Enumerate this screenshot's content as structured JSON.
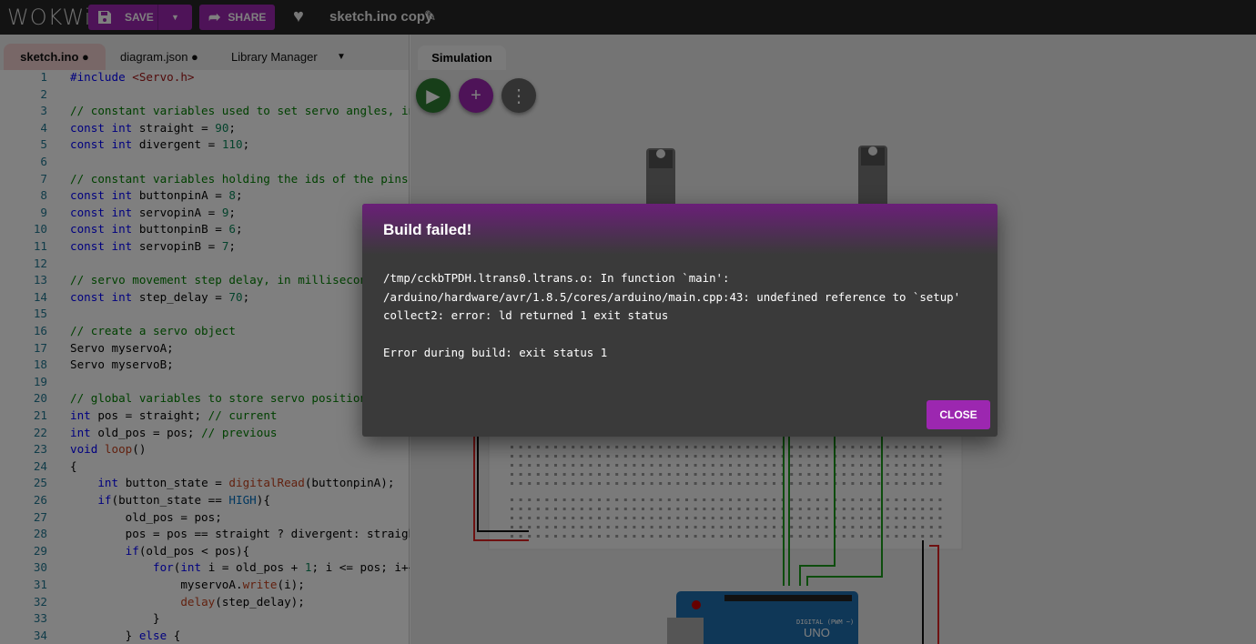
{
  "topbar": {
    "logo": "WOKWi",
    "save_label": "SAVE",
    "share_label": "SHARE",
    "project_title": "sketch.ino copy"
  },
  "editor": {
    "tabs": [
      {
        "label": "sketch.ino ●"
      },
      {
        "label": "diagram.json ●"
      },
      {
        "label": "Library Manager"
      }
    ],
    "lines": [
      [
        [
          "pp",
          "#include "
        ],
        [
          "str",
          "<Servo.h>"
        ]
      ],
      [],
      [
        [
          "cm",
          "// constant variables used to set servo angles, in degrees"
        ]
      ],
      [
        [
          "kw",
          "const int "
        ],
        [
          "",
          "straight = "
        ],
        [
          "num",
          "90"
        ],
        [
          "",
          ";"
        ]
      ],
      [
        [
          "kw",
          "const int "
        ],
        [
          "",
          "divergent = "
        ],
        [
          "num",
          "110"
        ],
        [
          "",
          ";"
        ]
      ],
      [],
      [
        [
          "cm",
          "// constant variables holding the ids of the pins we are using"
        ]
      ],
      [
        [
          "kw",
          "const int "
        ],
        [
          "",
          "buttonpinA = "
        ],
        [
          "num",
          "8"
        ],
        [
          "",
          ";"
        ]
      ],
      [
        [
          "kw",
          "const int "
        ],
        [
          "",
          "servopinA = "
        ],
        [
          "num",
          "9"
        ],
        [
          "",
          ";"
        ]
      ],
      [
        [
          "kw",
          "const int "
        ],
        [
          "",
          "buttonpinB = "
        ],
        [
          "num",
          "6"
        ],
        [
          "",
          ";"
        ]
      ],
      [
        [
          "kw",
          "const int "
        ],
        [
          "",
          "servopinB = "
        ],
        [
          "num",
          "7"
        ],
        [
          "",
          ";"
        ]
      ],
      [],
      [
        [
          "cm",
          "// servo movement step delay, in milliseconds"
        ]
      ],
      [
        [
          "kw",
          "const int "
        ],
        [
          "",
          "step_delay = "
        ],
        [
          "num",
          "70"
        ],
        [
          "",
          ";"
        ]
      ],
      [],
      [
        [
          "cm",
          "// create a servo object"
        ]
      ],
      [
        [
          "",
          "Servo myservoA;"
        ]
      ],
      [
        [
          "",
          "Servo myservoB;"
        ]
      ],
      [],
      [
        [
          "cm",
          "// global variables to store servo position"
        ]
      ],
      [
        [
          "kw",
          "int "
        ],
        [
          "",
          "pos = straight; "
        ],
        [
          "cm",
          "// current"
        ]
      ],
      [
        [
          "kw",
          "int "
        ],
        [
          "",
          "old_pos = pos; "
        ],
        [
          "cm",
          "// previous"
        ]
      ],
      [
        [
          "kw",
          "void "
        ],
        [
          "fn",
          "loop"
        ],
        [
          "",
          "()"
        ]
      ],
      [
        [
          "",
          "{"
        ]
      ],
      [
        [
          "",
          "    "
        ],
        [
          "kw",
          "int "
        ],
        [
          "",
          "button_state = "
        ],
        [
          "fn",
          "digitalRead"
        ],
        [
          "",
          "(buttonpinA);"
        ]
      ],
      [
        [
          "",
          "    "
        ],
        [
          "kw",
          "if"
        ],
        [
          "",
          "(button_state == "
        ],
        [
          "cn",
          "HIGH"
        ],
        [
          "",
          "){"
        ]
      ],
      [
        [
          "",
          "        old_pos = pos;"
        ]
      ],
      [
        [
          "",
          "        pos = pos == straight ? divergent: straight;"
        ]
      ],
      [
        [
          "",
          "        "
        ],
        [
          "kw",
          "if"
        ],
        [
          "",
          "(old_pos < pos){"
        ]
      ],
      [
        [
          "",
          "            "
        ],
        [
          "kw",
          "for"
        ],
        [
          "",
          "("
        ],
        [
          "kw",
          "int "
        ],
        [
          "",
          "i = old_pos + "
        ],
        [
          "num",
          "1"
        ],
        [
          "",
          "; i <= pos; i++){"
        ]
      ],
      [
        [
          "",
          "                myservoA."
        ],
        [
          "fn",
          "write"
        ],
        [
          "",
          "(i);"
        ]
      ],
      [
        [
          "",
          "                "
        ],
        [
          "fn",
          "delay"
        ],
        [
          "",
          "(step_delay);"
        ]
      ],
      [
        [
          "",
          "            }"
        ]
      ],
      [
        [
          "",
          "        } "
        ],
        [
          "kw",
          "else"
        ],
        [
          "",
          " {"
        ]
      ]
    ]
  },
  "simulation": {
    "tab_label": "Simulation",
    "board_label": "UNO",
    "digital_label": "DIGITAL (PWM ~)"
  },
  "dialog": {
    "title": "Build failed!",
    "message": "/tmp/cckbTPDH.ltrans0.ltrans.o: In function `main':\n/arduino/hardware/avr/1.8.5/cores/arduino/main.cpp:43: undefined reference to `setup'\ncollect2: error: ld returned 1 exit status\n\nError during build: exit status 1",
    "close_label": "CLOSE"
  }
}
